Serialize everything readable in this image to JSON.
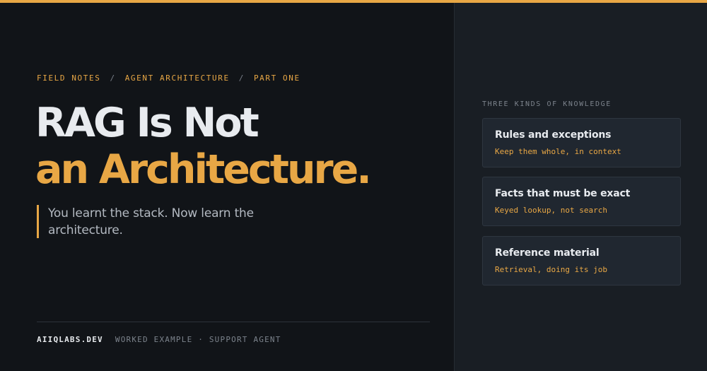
{
  "colors": {
    "accent": "#e8a745",
    "background": "#111418",
    "panel": "#191e24",
    "card": "#202730"
  },
  "kicker": {
    "part1": "FIELD NOTES",
    "sep": "/",
    "part2": "AGENT ARCHITECTURE",
    "part3": "PART ONE"
  },
  "title": {
    "line1": "RAG Is Not",
    "line2": "an Architecture."
  },
  "subtitle": "You learnt the stack. Now learn the architecture.",
  "footer": {
    "brand": "AIIQLABS.DEV",
    "meta": "WORKED EXAMPLE · SUPPORT AGENT"
  },
  "knowledge": {
    "heading": "THREE KINDS OF KNOWLEDGE",
    "cards": [
      {
        "title": "Rules and exceptions",
        "subtitle": "Keep them whole, in context"
      },
      {
        "title": "Facts that must be exact",
        "subtitle": "Keyed lookup, not search"
      },
      {
        "title": "Reference material",
        "subtitle": "Retrieval, doing its job"
      }
    ]
  }
}
